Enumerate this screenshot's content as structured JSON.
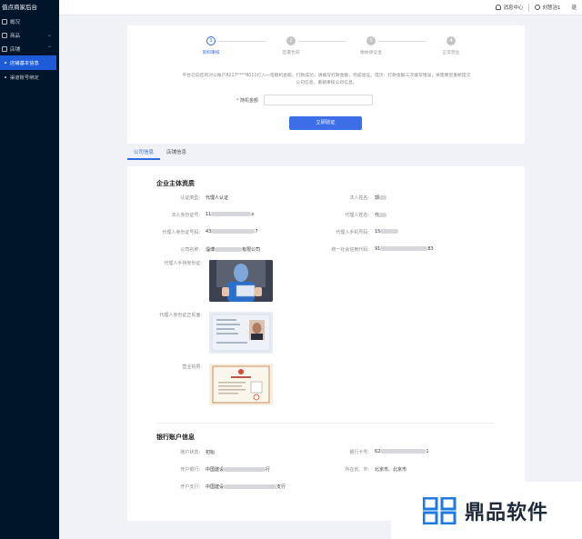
{
  "app": {
    "brand": "值点商家后台"
  },
  "sidebar": {
    "items": [
      {
        "label": "概况",
        "icon": "grid-icon"
      },
      {
        "label": "商品",
        "icon": "box-icon"
      },
      {
        "label": "店铺",
        "icon": "store-icon"
      }
    ],
    "subitems": [
      {
        "label": "店铺基本信息",
        "active": true
      },
      {
        "label": "渠道账号绑定",
        "active": false
      }
    ]
  },
  "topbar": {
    "messages": "消息中心",
    "user": "刘慧洁1",
    "logout": "退"
  },
  "steps": [
    {
      "num": "1",
      "label": "资料审核",
      "active": true
    },
    {
      "num": "2",
      "label": "签署合同",
      "active": false
    },
    {
      "num": "3",
      "label": "缴纳保证金",
      "active": false
    },
    {
      "num": "4",
      "label": "正常营业",
      "active": false
    }
  ],
  "verify": {
    "notice": "平台已向您的对公账户8217****8011打入一笔随机金额，打款成功，请填写打款金额，完成验证。提示：打款金额三次填写错误，将需要您重新提交公司信息，重新审核公司信息。",
    "amount_label": "随机金额",
    "button": "立即验证"
  },
  "tabs": [
    "公司信息",
    "店铺信息"
  ],
  "company": {
    "title": "企业主体资质",
    "fields": {
      "auth_type_k": "认证类型:",
      "auth_type_v": "代理人认证",
      "legal_name_k": "法人姓名:",
      "legal_name_v": "郭",
      "legal_id_k": "法人身份证号:",
      "legal_id_v": "11",
      "legal_id_end": "x",
      "agent_name_k": "代理人姓名:",
      "agent_name_v": "代",
      "agent_id_k": "代理人身份证号码:",
      "agent_id_v": "43",
      "agent_id_end": "7",
      "agent_phone_k": "代理人手机号码:",
      "agent_phone_v": "15",
      "company_name_k": "公司名称:",
      "company_name_v": "淄博",
      "company_name_end": "有限公司",
      "credit_code_k": "统一社会信用代码:",
      "credit_code_v": "91",
      "credit_code_end": "83",
      "handheld_k": "代理人手持身份证:",
      "id_front_back_k": "代理人身份证正反面:",
      "license_k": "营业执照:"
    }
  },
  "bank": {
    "title": "银行账户信息",
    "fields": {
      "status_k": "账户状态:",
      "status_v": "初始",
      "card_k": "银行卡号:",
      "card_v": "62",
      "card_end": "1",
      "bank_k": "开户银行:",
      "bank_v": "中国建设",
      "bank_end": "行",
      "region_k": "所在省、市:",
      "region_v": "北京市、北京市",
      "branch_k": "开户支行:",
      "branch_v": "中国建设",
      "branch_end": "支行"
    }
  },
  "watermark": {
    "text": "鼎品软件"
  }
}
